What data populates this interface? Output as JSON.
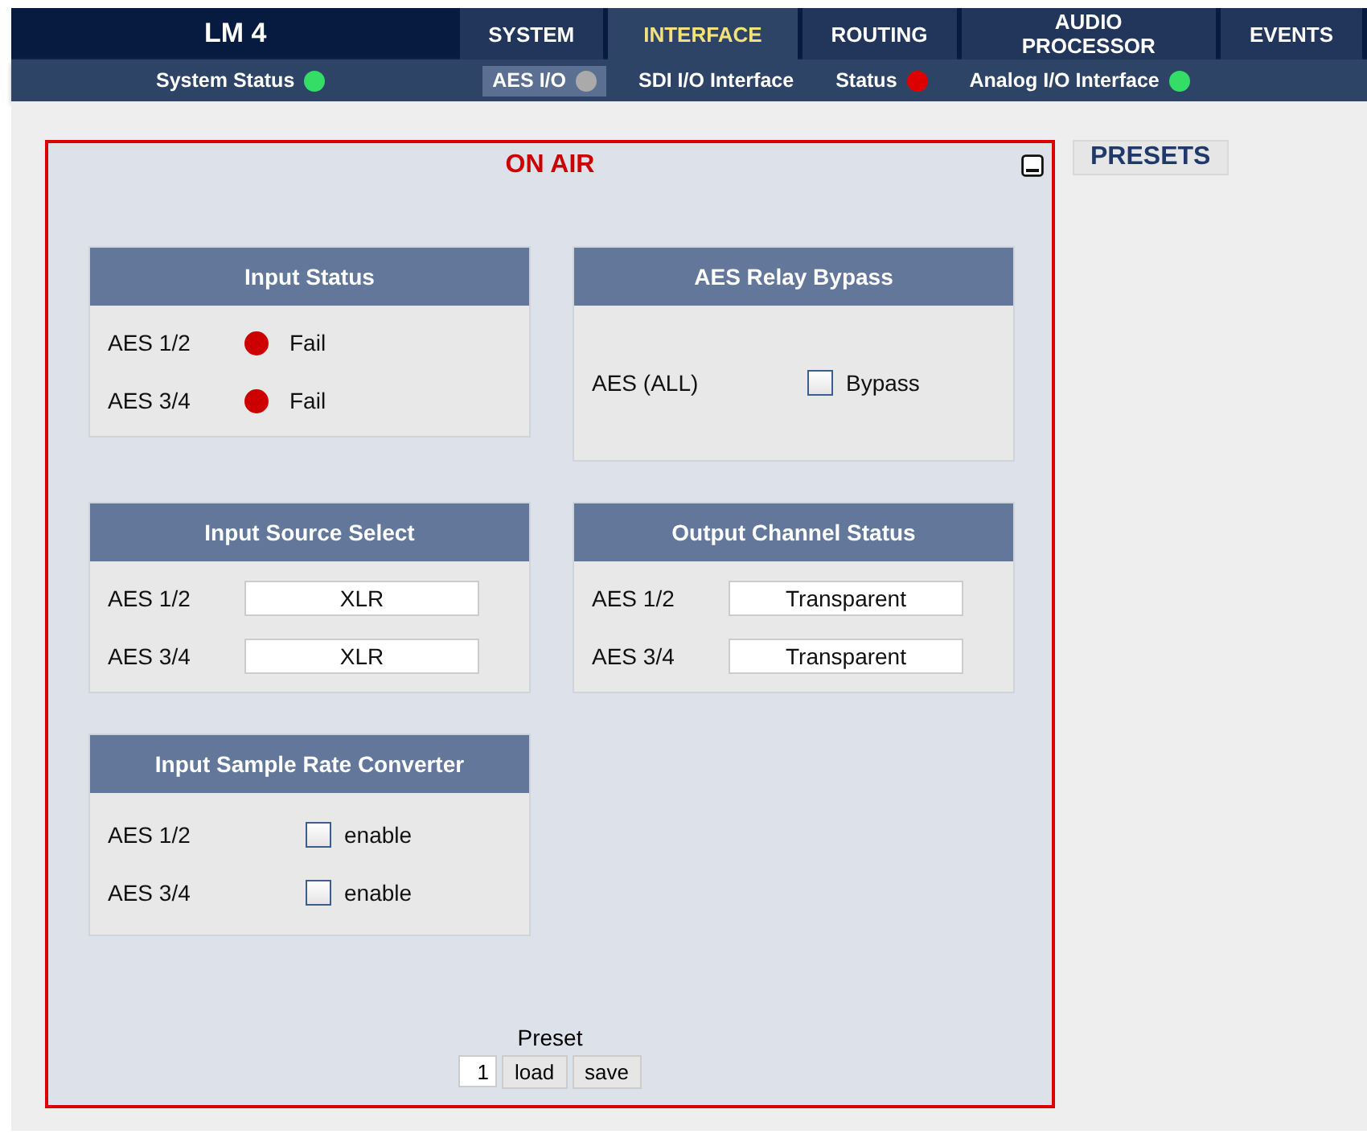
{
  "header": {
    "title": "LM 4",
    "tabs": [
      {
        "label": "SYSTEM",
        "selected": false
      },
      {
        "label": "INTERFACE",
        "selected": true
      },
      {
        "label": "ROUTING",
        "selected": false
      },
      {
        "label": "AUDIO PROCESSOR",
        "selected": false
      },
      {
        "label": "EVENTS",
        "selected": false
      }
    ],
    "subnav": [
      {
        "label": "System Status",
        "selected": false,
        "color": "#33dd66"
      },
      {
        "label": "AES I/O",
        "selected": true,
        "color": "#aaaaaa"
      },
      {
        "label": "SDI I/O Interface",
        "selected": false
      },
      {
        "label": "Status",
        "selected": false,
        "color": "#dd0000"
      },
      {
        "label": "Analog I/O Interface",
        "selected": false,
        "color": "#33dd66"
      }
    ]
  },
  "panel": {
    "title": "ON AIR",
    "presets_button": "PRESETS",
    "sections": [
      {
        "title": "Input Status",
        "kind": "status",
        "rows": [
          {
            "label": "AES 1/2",
            "status": "Fail",
            "color": "#cc0000"
          },
          {
            "label": "AES 3/4",
            "status": "Fail",
            "color": "#cc0000"
          }
        ]
      },
      {
        "title": "AES Relay Bypass",
        "kind": "checkbox",
        "rows": [
          {
            "label": "AES (ALL)",
            "option": "Bypass",
            "checked": false
          }
        ]
      },
      {
        "title": "Input Source Select",
        "kind": "value",
        "rows": [
          {
            "label": "AES 1/2",
            "value": "XLR"
          },
          {
            "label": "AES 3/4",
            "value": "XLR"
          }
        ]
      },
      {
        "title": "Output Channel Status",
        "kind": "value",
        "rows": [
          {
            "label": "AES 1/2",
            "value": "Transparent"
          },
          {
            "label": "AES 3/4",
            "value": "Transparent"
          }
        ]
      },
      {
        "title": "Input Sample Rate Converter",
        "kind": "checkbox",
        "rows": [
          {
            "label": "AES 1/2",
            "option": "enable",
            "checked": false
          },
          {
            "label": "AES 3/4",
            "option": "enable",
            "checked": false
          }
        ]
      }
    ],
    "preset": {
      "label": "Preset",
      "number": "1",
      "load": "load",
      "save": "save"
    }
  }
}
